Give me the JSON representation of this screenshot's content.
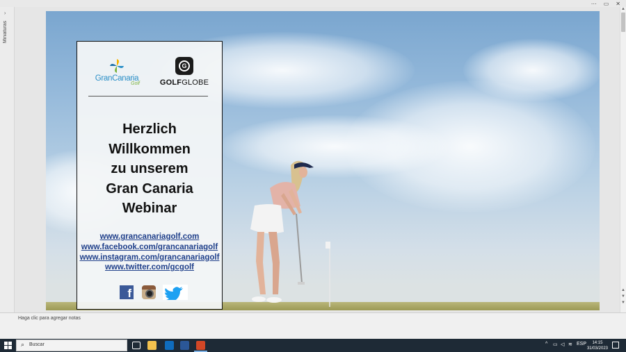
{
  "window": {
    "controls": [
      "⋯",
      "▭",
      "✕"
    ]
  },
  "thumbnails_pane": {
    "label": "Miniaturas",
    "toggle": "›"
  },
  "slide": {
    "logo_left": {
      "name": "GranCanaria",
      "sub": "Golf"
    },
    "logo_right": {
      "name_bold": "GOLF",
      "name_light": "GLOBE",
      "mark": "G"
    },
    "heading_lines": [
      "Herzlich",
      "Willkommen",
      "zu unserem",
      "Gran Canaria",
      "Webinar"
    ],
    "links": [
      "www.grancanariagolf.com",
      "www.facebook.com/grancanariagolf",
      "www.instagram.com/grancanariagolf",
      "www.twitter.com/gcgolf"
    ],
    "social_icons": [
      "facebook-icon",
      "instagram-icon",
      "twitter-icon"
    ],
    "facebook_glyph": "f"
  },
  "notes": {
    "placeholder": "Haga clic para agregar notas"
  },
  "taskbar": {
    "search_placeholder": "Buscar",
    "apps": [
      "task-view",
      "file-explorer",
      "outlook",
      "word",
      "powerpoint"
    ],
    "active_app": "powerpoint",
    "language": "ESP",
    "time": "14:15",
    "date": "31/03/2023"
  },
  "colors": {
    "sky_top": "#7aa6cf",
    "panel_bg": "#f3f5f7",
    "link": "#1f3f8a",
    "taskbar": "#1e2a36"
  }
}
